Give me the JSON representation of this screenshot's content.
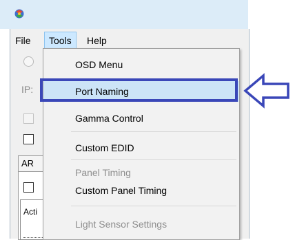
{
  "menubar": {
    "file": "File",
    "tools": "Tools",
    "help": "Help"
  },
  "background": {
    "ip_label": "IP:",
    "tab_label": "AR",
    "list_text": "Acti"
  },
  "tools_menu": {
    "items": [
      {
        "label": "OSD Menu",
        "enabled": true
      },
      {
        "label": "Port Naming",
        "enabled": true,
        "highlighted": true
      },
      {
        "label": "Gamma Control",
        "enabled": true
      },
      {
        "label": "Custom EDID",
        "enabled": true
      },
      {
        "label": "Panel Timing",
        "enabled": false
      },
      {
        "label": "Custom Panel Timing",
        "enabled": true
      },
      {
        "label": "Light Sensor Settings",
        "enabled": false
      }
    ]
  },
  "colors": {
    "highlight_border": "#3a47b8",
    "arrow_outline": "#3a47b8",
    "selected_item": "#cce4f7",
    "titlebar": "#dcecf8"
  },
  "icons": [
    "app-icon",
    "arrow-left-icon"
  ]
}
